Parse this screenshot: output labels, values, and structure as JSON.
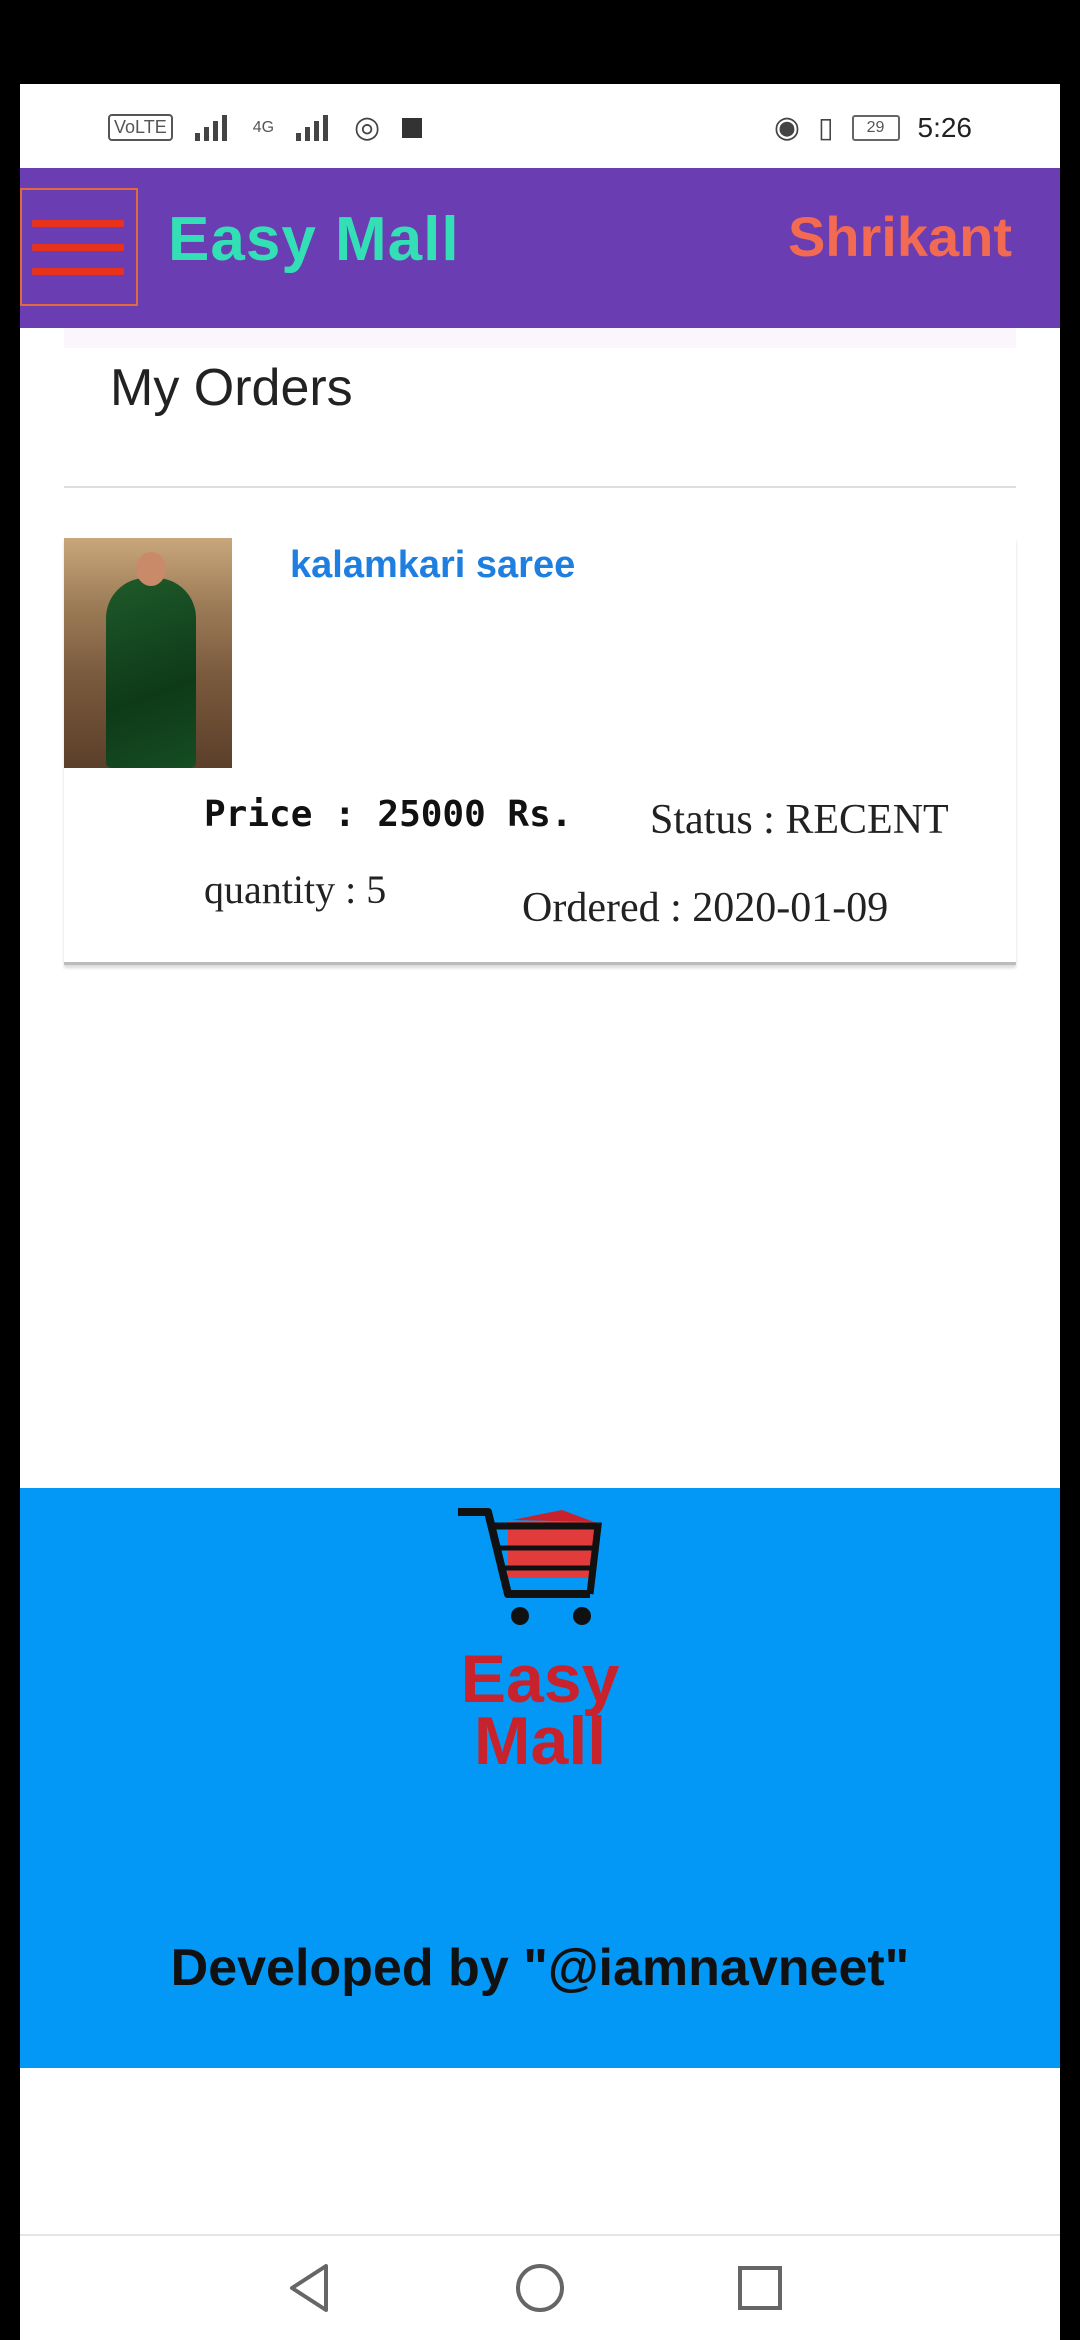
{
  "status_bar": {
    "network_chip": "VoLTE",
    "network_type": "4G",
    "battery": "29",
    "time": "5:26"
  },
  "app_bar": {
    "title": "Easy Mall",
    "user_name": "Shrikant",
    "colors": {
      "background": "#6a3db3",
      "title": "#33e0b6",
      "user": "#f26a52",
      "menu": "#e8331c"
    }
  },
  "page": {
    "title": "My Orders"
  },
  "orders": [
    {
      "product_name": "kalamkari saree",
      "price_text": "Price : 25000 Rs.",
      "status_text": "Status : RECENT",
      "quantity_text": "quantity : 5",
      "ordered_text": "Ordered : 2020-01-09"
    }
  ],
  "footer": {
    "logo_line1": "Easy",
    "logo_line2": "Mall",
    "developer_text": "Developed by \"@iamnavneet\"",
    "colors": {
      "background": "#0398f5",
      "logo": "#c8232c"
    }
  },
  "nav_bar": {
    "icons": [
      "back-icon",
      "home-icon",
      "recents-icon"
    ]
  }
}
